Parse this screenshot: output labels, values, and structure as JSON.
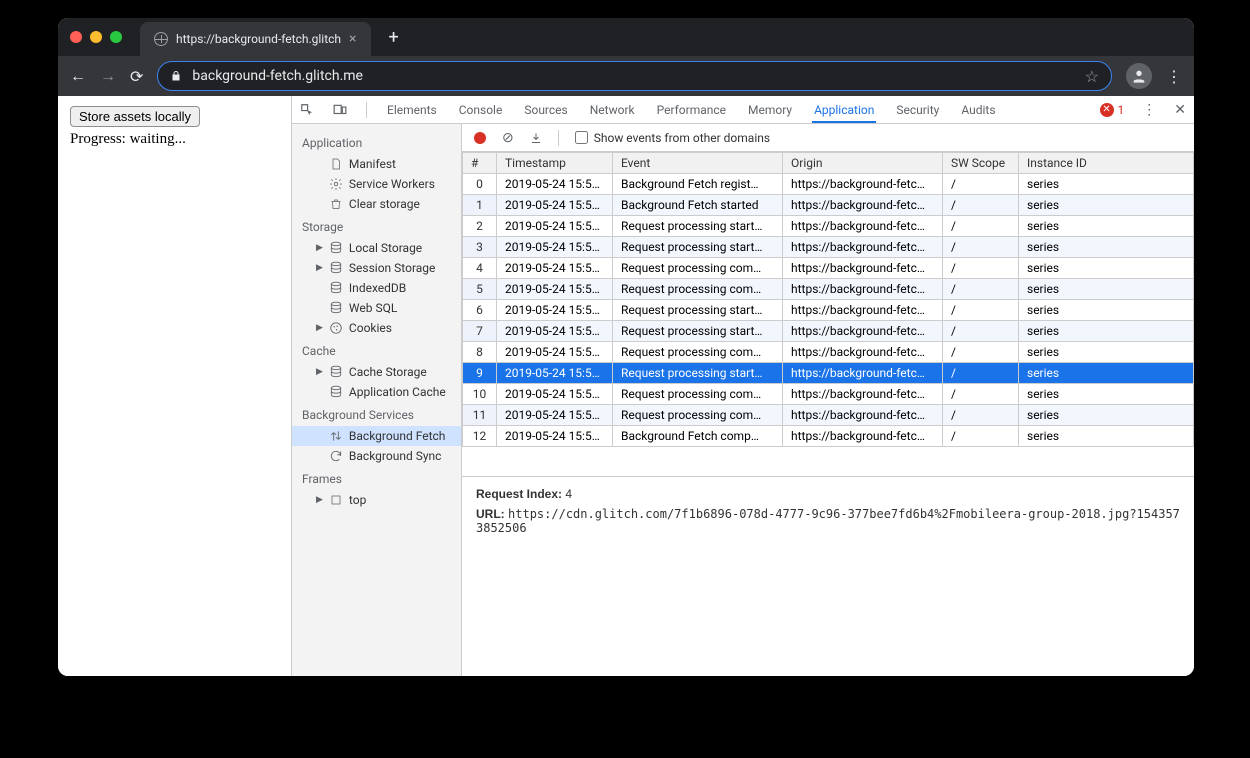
{
  "browser": {
    "tab_title": "https://background-fetch.glitch",
    "url_display": "background-fetch.glitch.me"
  },
  "page": {
    "button_label": "Store assets locally",
    "progress_text": "Progress: waiting..."
  },
  "devtools": {
    "tabs": [
      "Elements",
      "Console",
      "Sources",
      "Network",
      "Performance",
      "Memory",
      "Application",
      "Security",
      "Audits"
    ],
    "active_tab": "Application",
    "error_count": "1"
  },
  "app_sidebar": {
    "sections": [
      {
        "title": "Application",
        "items": [
          {
            "label": "Manifest",
            "icon": "file"
          },
          {
            "label": "Service Workers",
            "icon": "gear"
          },
          {
            "label": "Clear storage",
            "icon": "trash"
          }
        ]
      },
      {
        "title": "Storage",
        "items": [
          {
            "label": "Local Storage",
            "icon": "db",
            "expandable": true
          },
          {
            "label": "Session Storage",
            "icon": "db",
            "expandable": true
          },
          {
            "label": "IndexedDB",
            "icon": "db"
          },
          {
            "label": "Web SQL",
            "icon": "db"
          },
          {
            "label": "Cookies",
            "icon": "cookie",
            "expandable": true
          }
        ]
      },
      {
        "title": "Cache",
        "items": [
          {
            "label": "Cache Storage",
            "icon": "db",
            "expandable": true
          },
          {
            "label": "Application Cache",
            "icon": "db"
          }
        ]
      },
      {
        "title": "Background Services",
        "items": [
          {
            "label": "Background Fetch",
            "icon": "updown",
            "selected": true
          },
          {
            "label": "Background Sync",
            "icon": "sync"
          }
        ]
      },
      {
        "title": "Frames",
        "items": [
          {
            "label": "top",
            "icon": "frame",
            "expandable": true
          }
        ]
      }
    ]
  },
  "toolbar": {
    "checkbox_label": "Show events from other domains"
  },
  "table": {
    "columns": [
      "#",
      "Timestamp",
      "Event",
      "Origin",
      "SW Scope",
      "Instance ID"
    ],
    "rows": [
      {
        "n": "0",
        "ts": "2019-05-24 15:5…",
        "ev": "Background Fetch regist…",
        "or": "https://background-fetc…",
        "sw": "/",
        "id": "series"
      },
      {
        "n": "1",
        "ts": "2019-05-24 15:5…",
        "ev": "Background Fetch started",
        "or": "https://background-fetc…",
        "sw": "/",
        "id": "series"
      },
      {
        "n": "2",
        "ts": "2019-05-24 15:5…",
        "ev": "Request processing start…",
        "or": "https://background-fetc…",
        "sw": "/",
        "id": "series"
      },
      {
        "n": "3",
        "ts": "2019-05-24 15:5…",
        "ev": "Request processing start…",
        "or": "https://background-fetc…",
        "sw": "/",
        "id": "series"
      },
      {
        "n": "4",
        "ts": "2019-05-24 15:5…",
        "ev": "Request processing com…",
        "or": "https://background-fetc…",
        "sw": "/",
        "id": "series"
      },
      {
        "n": "5",
        "ts": "2019-05-24 15:5…",
        "ev": "Request processing com…",
        "or": "https://background-fetc…",
        "sw": "/",
        "id": "series"
      },
      {
        "n": "6",
        "ts": "2019-05-24 15:5…",
        "ev": "Request processing start…",
        "or": "https://background-fetc…",
        "sw": "/",
        "id": "series"
      },
      {
        "n": "7",
        "ts": "2019-05-24 15:5…",
        "ev": "Request processing start…",
        "or": "https://background-fetc…",
        "sw": "/",
        "id": "series"
      },
      {
        "n": "8",
        "ts": "2019-05-24 15:5…",
        "ev": "Request processing com…",
        "or": "https://background-fetc…",
        "sw": "/",
        "id": "series"
      },
      {
        "n": "9",
        "ts": "2019-05-24 15:5…",
        "ev": "Request processing start…",
        "or": "https://background-fetc…",
        "sw": "/",
        "id": "series",
        "selected": true
      },
      {
        "n": "10",
        "ts": "2019-05-24 15:5…",
        "ev": "Request processing com…",
        "or": "https://background-fetc…",
        "sw": "/",
        "id": "series"
      },
      {
        "n": "11",
        "ts": "2019-05-24 15:5…",
        "ev": "Request processing com…",
        "or": "https://background-fetc…",
        "sw": "/",
        "id": "series"
      },
      {
        "n": "12",
        "ts": "2019-05-24 15:5…",
        "ev": "Background Fetch comp…",
        "or": "https://background-fetc…",
        "sw": "/",
        "id": "series"
      }
    ]
  },
  "detail": {
    "request_index_label": "Request Index:",
    "request_index_value": "4",
    "url_label": "URL:",
    "url_value": "https://cdn.glitch.com/7f1b6896-078d-4777-9c96-377bee7fd6b4%2Fmobileera-group-2018.jpg?1543573852506"
  }
}
